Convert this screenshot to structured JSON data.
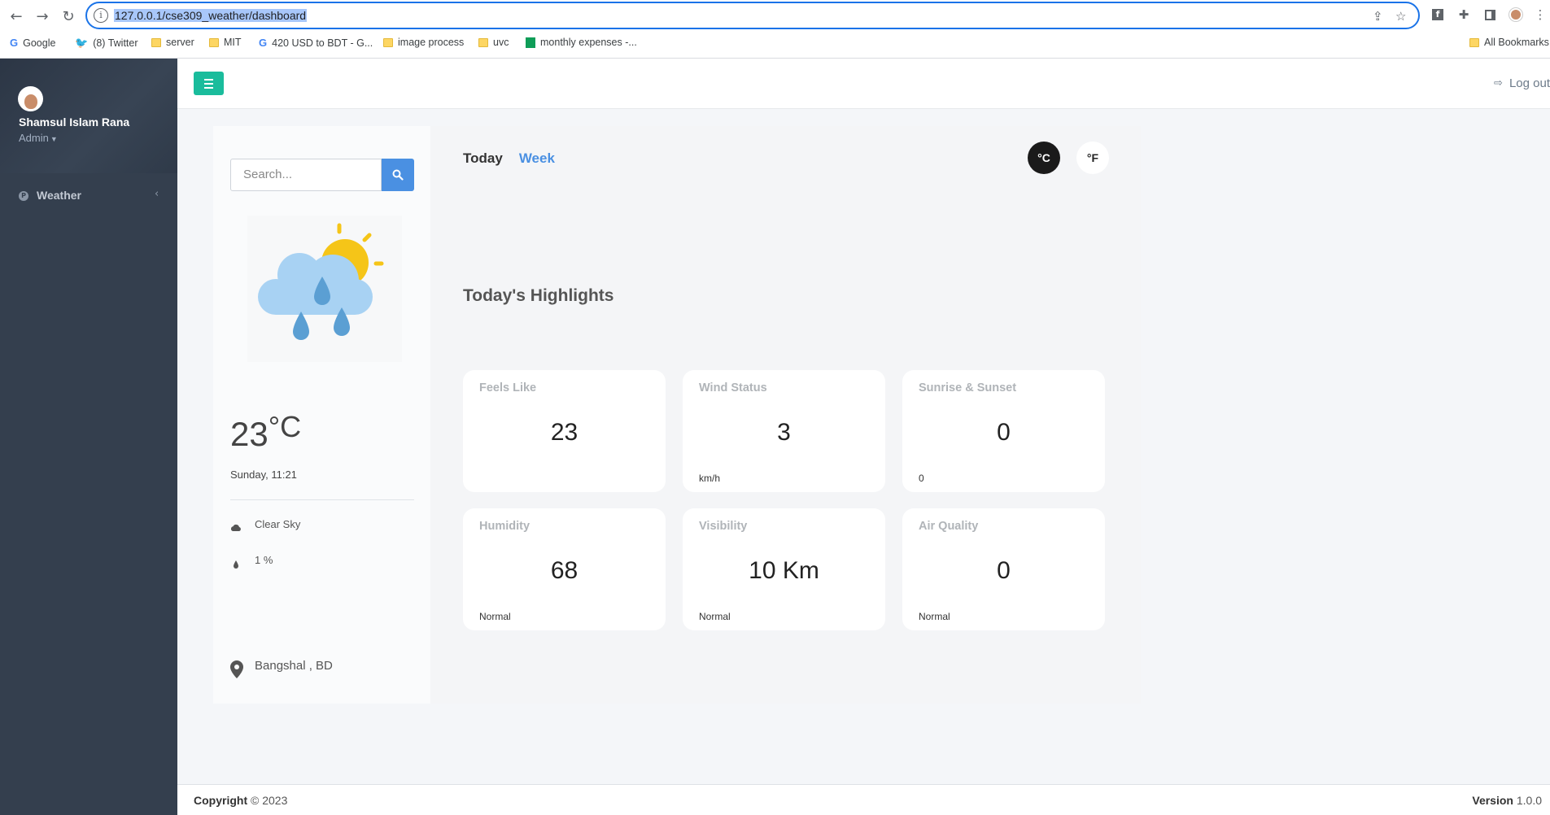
{
  "browser": {
    "url": "127.0.0.1/cse309_weather/dashboard",
    "bookmarks": [
      {
        "label": "Google",
        "icon": "google-icon"
      },
      {
        "label": "(8) Twitter",
        "icon": "twitter-icon"
      },
      {
        "label": "server",
        "icon": "folder-icon"
      },
      {
        "label": "MIT",
        "icon": "folder-icon"
      },
      {
        "label": "420 USD to BDT - G...",
        "icon": "google-icon"
      },
      {
        "label": "image process",
        "icon": "folder-icon"
      },
      {
        "label": "uvc",
        "icon": "folder-icon"
      },
      {
        "label": "monthly expenses -...",
        "icon": "sheets-icon"
      }
    ],
    "all_bookmarks": "All Bookmarks"
  },
  "sidebar": {
    "user_name": "Shamsul Islam Rana",
    "user_role": "Admin",
    "items": [
      {
        "label": "Weather",
        "icon": "p-circle-icon"
      }
    ],
    "bg_color": "#343f4e"
  },
  "topbar": {
    "logout_label": "Log out",
    "menu_color": "#1abc9c"
  },
  "search": {
    "placeholder": "Search..."
  },
  "current": {
    "temp": "23",
    "unit": "°C",
    "datetime": "Sunday, 11:21",
    "condition": "Clear Sky",
    "rain": "1 %",
    "location": "Bangshal , BD"
  },
  "tabs": {
    "today": "Today",
    "week": "Week"
  },
  "units": {
    "celsius": "°C",
    "fahrenheit": "°F"
  },
  "highlights": {
    "title": "Today's Highlights",
    "cards": [
      {
        "title": "Feels Like",
        "value": "23",
        "sub": ""
      },
      {
        "title": "Wind Status",
        "value": "3",
        "sub": "km/h"
      },
      {
        "title": "Sunrise & Sunset",
        "value": "0",
        "sub": "0"
      },
      {
        "title": "Humidity",
        "value": "68",
        "sub": "Normal"
      },
      {
        "title": "Visibility",
        "value": "10 Km",
        "sub": "Normal"
      },
      {
        "title": "Air Quality",
        "value": "0",
        "sub": "Normal"
      }
    ]
  },
  "footer": {
    "copyright_label": "Copyright",
    "copyright_year": "© 2023",
    "version_label": "Version",
    "version": "1.0.0"
  }
}
